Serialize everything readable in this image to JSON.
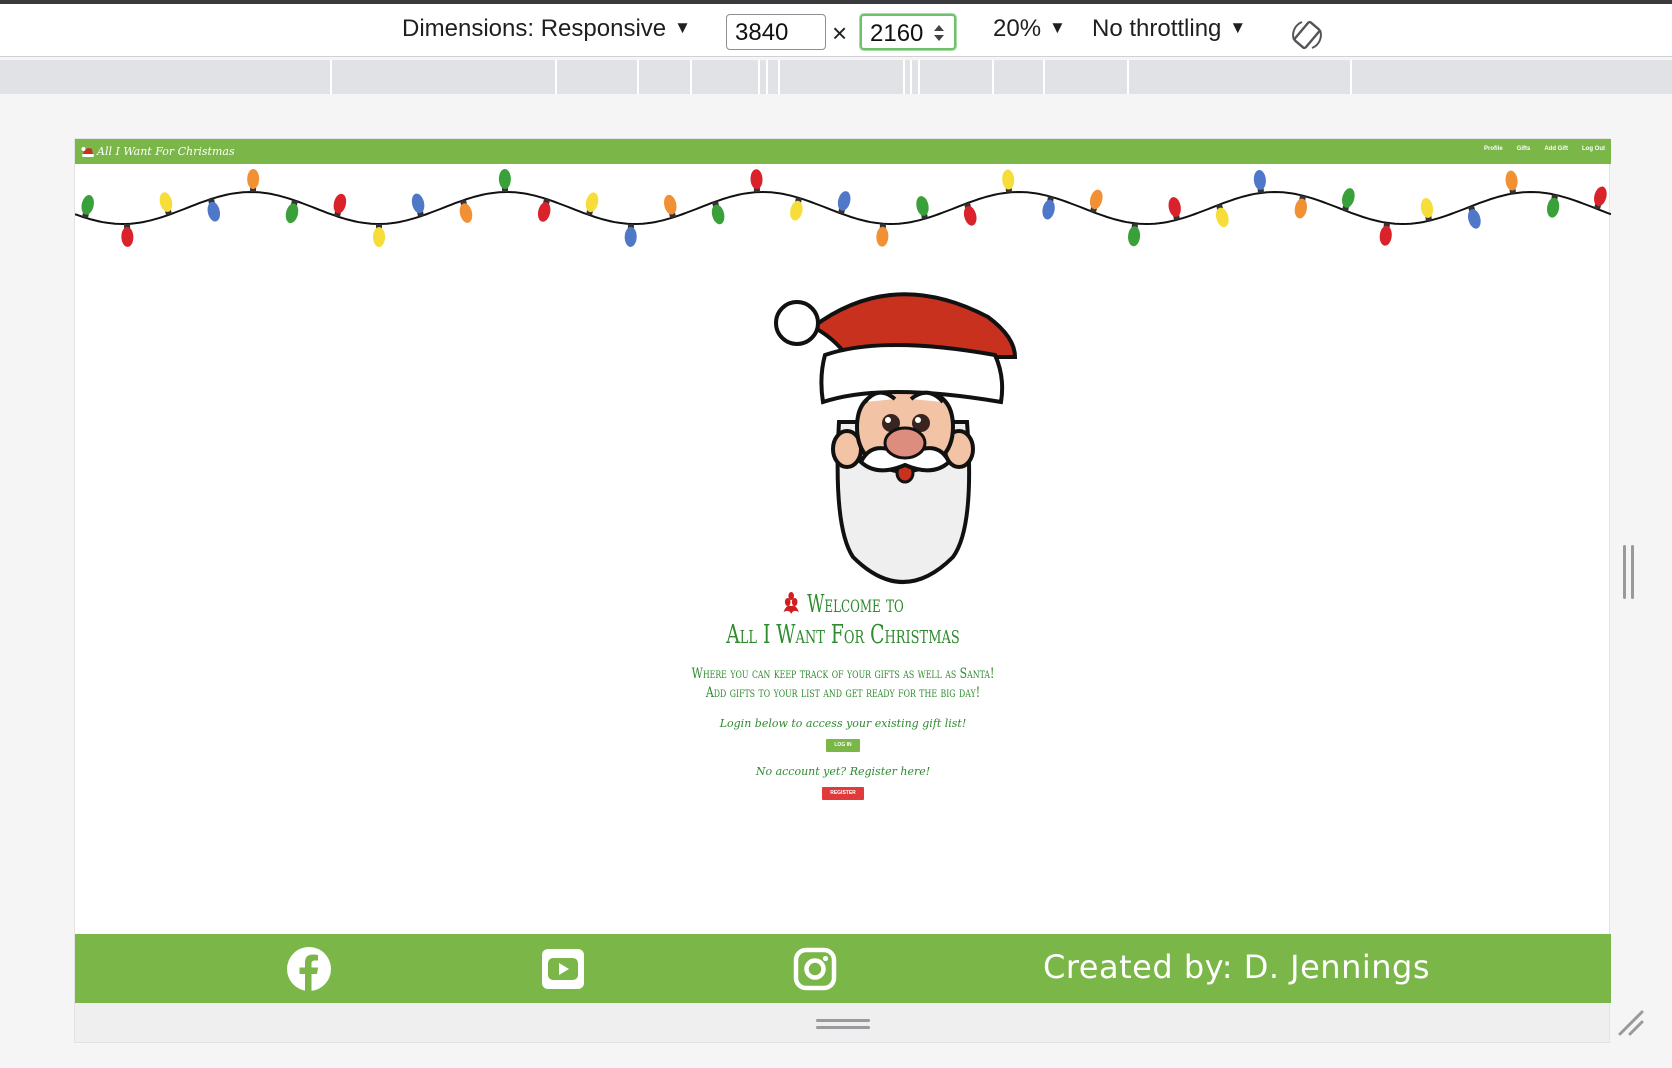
{
  "devtools": {
    "dimensions_label": "Dimensions: Responsive",
    "width_value": "3840",
    "times_symbol": "×",
    "height_value": "2160",
    "zoom_label": "20%",
    "throttling_label": "No throttling",
    "caret": "▼"
  },
  "site": {
    "brand": "All I Want For Christmas",
    "nav": [
      "Profile",
      "Gifts",
      "Add Gift",
      "Log Out"
    ],
    "welcome_line1": "Welcome to",
    "welcome_line2": "All I Want For Christmas",
    "tagline_line1": "Where you can keep track of your gifts as well as Santa!",
    "tagline_line2": "Add gifts to your list and get ready for the big day!",
    "login_hint": "Login below to access your existing gift list!",
    "login_button": "LOG IN",
    "register_hint": "No account yet? Register here!",
    "register_button": "REGISTER",
    "credit": "Created by: D. Jennings",
    "colors": {
      "nav_green": "#7ab648",
      "text_green": "#2e8b2e",
      "register_red": "#e03a3a"
    },
    "footer_icons": [
      "facebook-icon",
      "youtube-icon",
      "instagram-icon"
    ]
  }
}
